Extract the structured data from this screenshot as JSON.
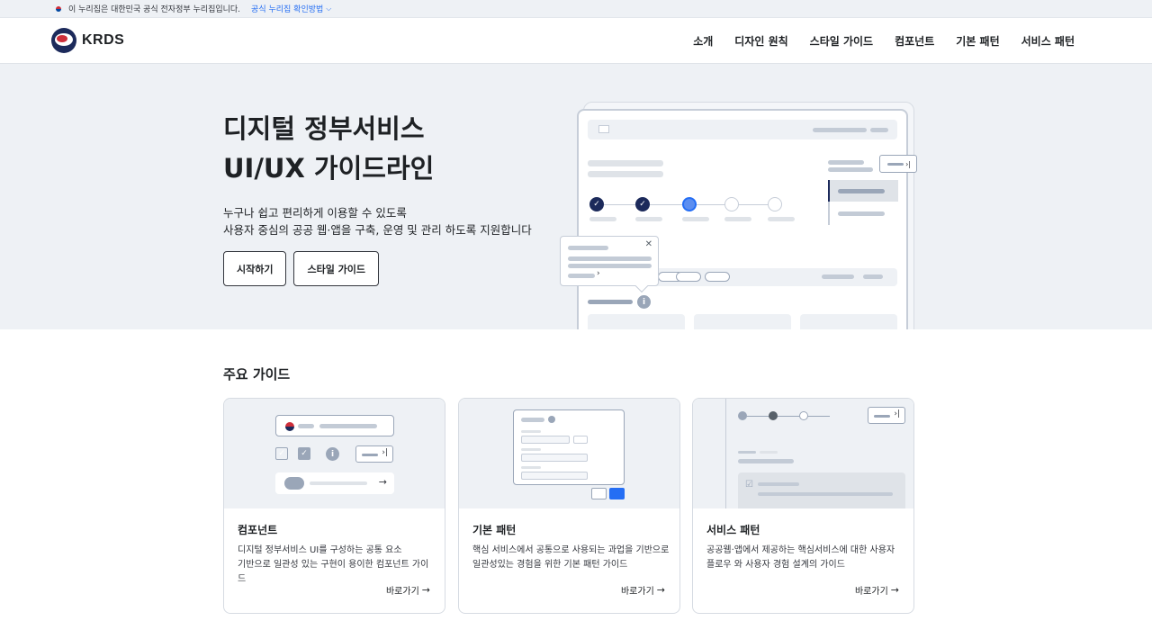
{
  "banner": {
    "text": "이 누리집은 대한민국 공식 전자정부 누리집입니다.",
    "verify_label": "공식 누리집 확인방법"
  },
  "header": {
    "logo_text": "KRDS",
    "nav": [
      "소개",
      "디자인 원칙",
      "스타일 가이드",
      "컴포넌트",
      "기본 패턴",
      "서비스 패턴"
    ]
  },
  "hero": {
    "title_line1": "디지털 정부서비스",
    "title_line2": "UI/UX 가이드라인",
    "desc_line1": "누구나 쉽고 편리하게 이용할 수 있도록",
    "desc_line2": "사용자 중심의 공공 웹·앱을 구축, 운영 및 관리 하도록 지원합니다",
    "btn_start": "시작하기",
    "btn_style": "스타일 가이드"
  },
  "guides": {
    "section_title": "주요 가이드",
    "cards": [
      {
        "title": "컴포넌트",
        "desc_line1": "디지털 정부서비스 UI를 구성하는 공통 요소",
        "desc_line2": "기반으로 일관성 있는 구현이 용이한 컴포넌트 가이드",
        "link": "바로가기"
      },
      {
        "title": "기본 패턴",
        "desc_line1": "핵심 서비스에서 공통으로 사용되는 과업을 기반으로",
        "desc_line2": "일관성있는 경험을 위한 기본 패턴 가이드",
        "link": "바로가기"
      },
      {
        "title": "서비스 패턴",
        "desc_line1": "공공웹·앱에서 제공하는 핵심서비스에 대한 사용자",
        "desc_line2": "플로우 와 사용자 경험 설계의 가이드",
        "link": "바로가기"
      }
    ]
  },
  "icons": {
    "flag": "korea-flag-icon",
    "chevron": "chevron-down-icon",
    "arrow": "arrow-right-icon"
  },
  "colors": {
    "accent": "#256ef4",
    "navy": "#1c2a5b",
    "hero_bg": "#eef1f5"
  }
}
